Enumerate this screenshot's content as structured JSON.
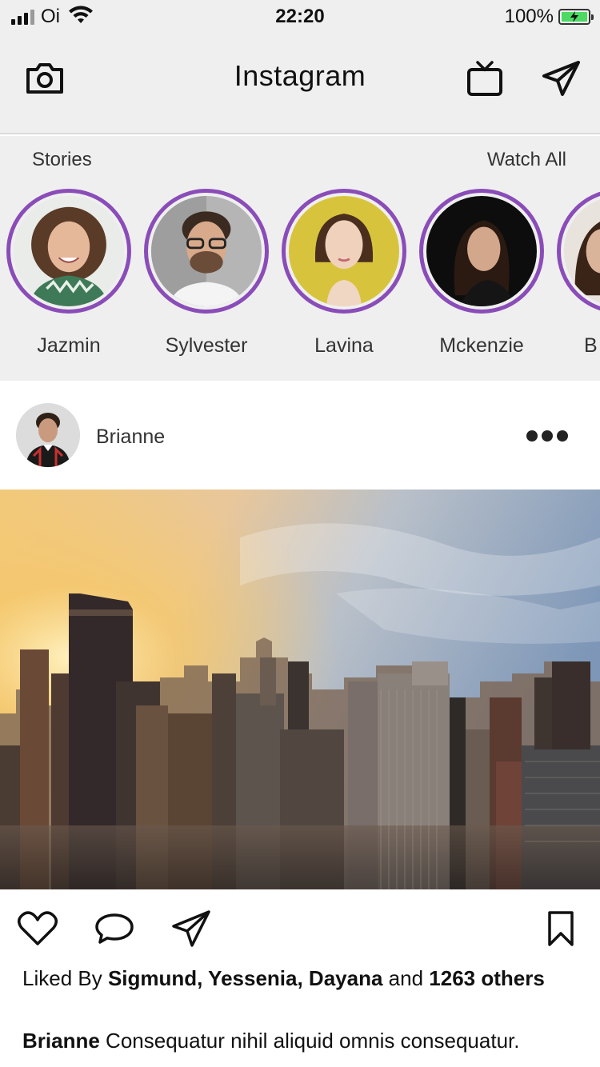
{
  "status_bar": {
    "carrier": "Oi",
    "time": "22:20",
    "battery": "100%"
  },
  "nav": {
    "title": "Instagram",
    "icons": [
      "camera-icon",
      "tv-icon",
      "send-icon"
    ]
  },
  "stories": {
    "header": "Stories",
    "watch_all": "Watch All",
    "items": [
      {
        "name": "Jazmin"
      },
      {
        "name": "Sylvester"
      },
      {
        "name": "Lavina"
      },
      {
        "name": "Mckenzie"
      },
      {
        "name": "B"
      }
    ]
  },
  "post": {
    "username": "Brianne",
    "likes": {
      "prefix": "Liked By",
      "names": "Sigmund, Yessenia, Dayana",
      "conjunction": "and",
      "count_text": "1263 others"
    },
    "caption": {
      "author": "Brianne",
      "text": "Consequatur nihil aliquid omnis consequatur."
    },
    "icons": [
      "heart-icon",
      "comment-icon",
      "share-icon",
      "bookmark-icon",
      "more-icon"
    ]
  },
  "colors": {
    "story_ring": "#8a4db8",
    "bar_background": "#efefef",
    "battery_fill": "#4cd964"
  }
}
